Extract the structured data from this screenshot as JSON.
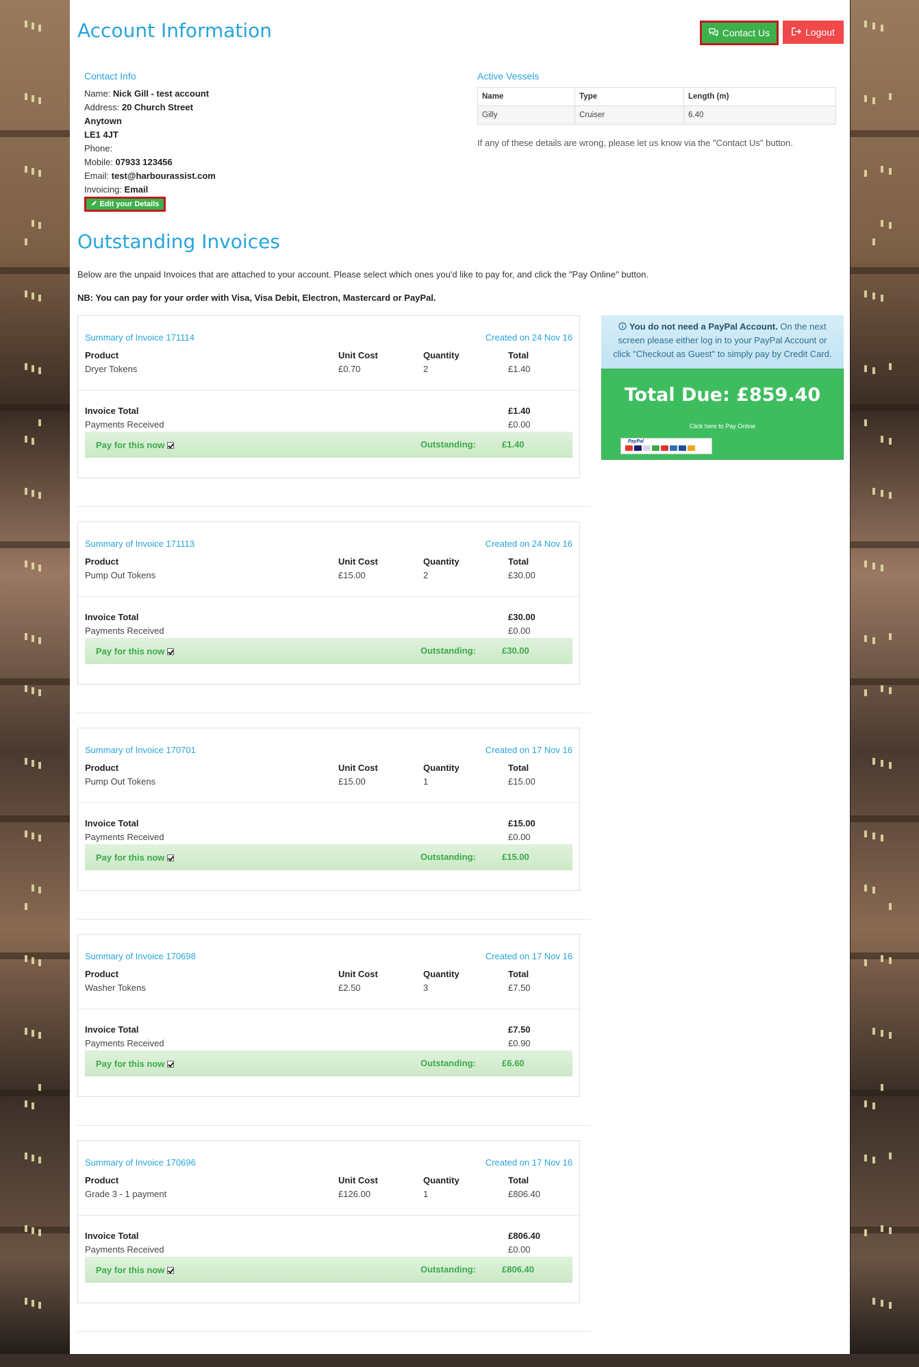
{
  "header": {
    "title": "Account Information",
    "contact_label": "Contact Us",
    "logout_label": "Logout"
  },
  "contact": {
    "section_label": "Contact Info",
    "name_label": "Name:",
    "name": "Nick Gill - test account",
    "address_label": "Address:",
    "address_line1": "20 Church Street",
    "address_line2": "Anytown",
    "address_line3": "LE1 4JT",
    "phone_label": "Phone:",
    "phone": "",
    "mobile_label": "Mobile:",
    "mobile": "07933 123456",
    "email_label": "Email:",
    "email": "test@harbourassist.com",
    "invoicing_label": "Invoicing:",
    "invoicing": "Email",
    "edit_label": "Edit your Details"
  },
  "vessels": {
    "section_label": "Active Vessels",
    "columns": [
      "Name",
      "Type",
      "Length (m)"
    ],
    "rows": [
      [
        "Gilly",
        "Cruiser",
        "6.40"
      ]
    ],
    "note": "If any of these details are wrong, please let us know via the \"Contact Us\" button."
  },
  "outstanding": {
    "title": "Outstanding Invoices",
    "intro": "Below are the unpaid Invoices that are attached to your account. Please select which ones you'd like to pay for, and click the \"Pay Online\" button.",
    "nb": "NB: You can pay for your order with Visa, Visa Debit, Electron, Mastercard or PayPal."
  },
  "invoice_labels": {
    "product": "Product",
    "unit_cost": "Unit Cost",
    "quantity": "Quantity",
    "total": "Total",
    "invoice_total": "Invoice Total",
    "payments_received": "Payments Received",
    "pay_now": "Pay for this now",
    "outstanding": "Outstanding:"
  },
  "invoices": [
    {
      "title": "Summary of Invoice 171114",
      "created": "Created on 24 Nov 16",
      "product": "Dryer Tokens",
      "unit_cost": "£0.70",
      "quantity": "2",
      "total": "£1.40",
      "invoice_total": "£1.40",
      "payments": "£0.00",
      "outstanding": "£1.40"
    },
    {
      "title": "Summary of Invoice 171113",
      "created": "Created on 24 Nov 16",
      "product": "Pump Out Tokens",
      "unit_cost": "£15.00",
      "quantity": "2",
      "total": "£30.00",
      "invoice_total": "£30.00",
      "payments": "£0.00",
      "outstanding": "£30.00"
    },
    {
      "title": "Summary of Invoice 170701",
      "created": "Created on 17 Nov 16",
      "product": "Pump Out Tokens",
      "unit_cost": "£15.00",
      "quantity": "1",
      "total": "£15.00",
      "invoice_total": "£15.00",
      "payments": "£0.00",
      "outstanding": "£15.00"
    },
    {
      "title": "Summary of Invoice 170698",
      "created": "Created on 17 Nov 16",
      "product": "Washer Tokens",
      "unit_cost": "£2.50",
      "quantity": "3",
      "total": "£7.50",
      "invoice_total": "£7.50",
      "payments": "£0.90",
      "outstanding": "£6.60"
    },
    {
      "title": "Summary of Invoice 170696",
      "created": "Created on 17 Nov 16",
      "product": "Grade 3 - 1 payment",
      "unit_cost": "£126.00",
      "quantity": "1",
      "total": "£806.40",
      "invoice_total": "£806.40",
      "payments": "£0.00",
      "outstanding": "£806.40"
    }
  ],
  "paypal": {
    "note_bold": "You do not need a PayPal Account.",
    "note_rest": " On the next screen please either log in to your PayPal Account or click \"Checkout as Guest\" to simply pay by Credit Card.",
    "total_due": "Total Due: £859.40",
    "click_label": "Click here to Pay Online",
    "logo_text": "PayPal"
  },
  "colors": {
    "accent": "#27a4dd",
    "green": "#3cb04a",
    "red": "#f0484b"
  }
}
